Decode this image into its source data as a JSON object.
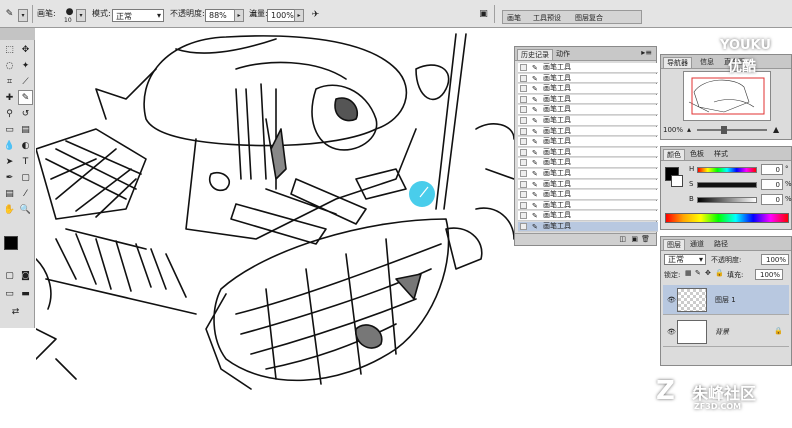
{
  "options_bar": {
    "brush_label": "画笔:",
    "brush_size": "10",
    "mode_label": "模式:",
    "mode_value": "正常",
    "opacity_label": "不透明度:",
    "opacity_value": "88%",
    "flow_label": "流量:",
    "flow_value": "100%"
  },
  "dock_tabs": [
    "画笔",
    "工具预设",
    "图层复合"
  ],
  "history_panel": {
    "tabs": [
      "历史记录",
      "动作"
    ],
    "items": [
      "画笔工具",
      "画笔工具",
      "画笔工具",
      "画笔工具",
      "画笔工具",
      "画笔工具",
      "画笔工具",
      "画笔工具",
      "画笔工具",
      "画笔工具",
      "画笔工具",
      "画笔工具",
      "画笔工具",
      "画笔工具",
      "画笔工具",
      "画笔工具"
    ]
  },
  "navigator_panel": {
    "tabs": [
      "导航器",
      "信息",
      "直方图"
    ],
    "zoom": "100%"
  },
  "color_panel": {
    "tabs": [
      "颜色",
      "色板",
      "样式"
    ],
    "h_label": "H",
    "s_label": "S",
    "b_label": "B",
    "h_value": "0",
    "s_value": "0",
    "b_value": "0",
    "degree_unit": "°",
    "pct_unit": "%"
  },
  "layers_panel": {
    "tabs": [
      "图层",
      "通道",
      "路径"
    ],
    "blend_mode": "正常",
    "opacity_label": "不透明度:",
    "opacity_value": "100%",
    "lock_label": "锁定:",
    "fill_label": "填充:",
    "fill_value": "100%",
    "layers": [
      {
        "name": "图层 1"
      },
      {
        "name": "背景"
      }
    ]
  },
  "watermarks": {
    "youku": "YOUKU",
    "youku_cn": "优酷",
    "zhufeng": "朱峰社区",
    "zhufeng_url": "ZF3D.COM"
  },
  "colors": {
    "ui_gray": "#dcdcdc",
    "brush_cursor": "#29c4e8",
    "selection_blue": "#b8c8e0"
  }
}
